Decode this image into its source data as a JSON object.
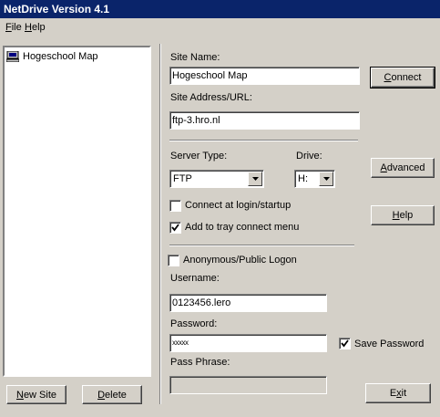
{
  "window": {
    "title": "NetDrive Version 4.1"
  },
  "menu": {
    "file": {
      "accel": "F",
      "rest": "ile"
    },
    "help": {
      "accel": "H",
      "rest": "elp"
    }
  },
  "sites": [
    {
      "label": "Hogeschool Map",
      "icon": "computer-icon"
    }
  ],
  "buttons": {
    "new_site": {
      "accel": "N",
      "rest": "ew Site"
    },
    "delete": {
      "accel": "D",
      "rest": "elete"
    },
    "connect": {
      "accel": "C",
      "rest": "onnect"
    },
    "advanced": {
      "accel": "A",
      "rest": "dvanced"
    },
    "help": {
      "accel": "H",
      "rest": "elp"
    },
    "exit": {
      "pre": "E",
      "accel": "x",
      "rest": "it"
    }
  },
  "form": {
    "site_name_label": "Site Name:",
    "site_name_value": "Hogeschool Map",
    "site_address_label": "Site Address/URL:",
    "site_address_value": "ftp-3.hro.nl",
    "server_type_label": "Server Type:",
    "server_type_value": "FTP",
    "drive_label": "Drive:",
    "drive_value": "H:",
    "connect_at_login_label": "Connect at login/startup",
    "connect_at_login_checked": false,
    "add_to_tray_label": "Add to tray connect menu",
    "add_to_tray_checked": true,
    "anonymous_label": "Anonymous/Public Logon",
    "anonymous_checked": false,
    "username_label": "Username:",
    "username_value": "0123456.lero",
    "password_label": "Password:",
    "password_value": "xxxxx",
    "save_password_label": "Save Password",
    "save_password_checked": true,
    "pass_phrase_label": "Pass Phrase:",
    "pass_phrase_value": ""
  }
}
